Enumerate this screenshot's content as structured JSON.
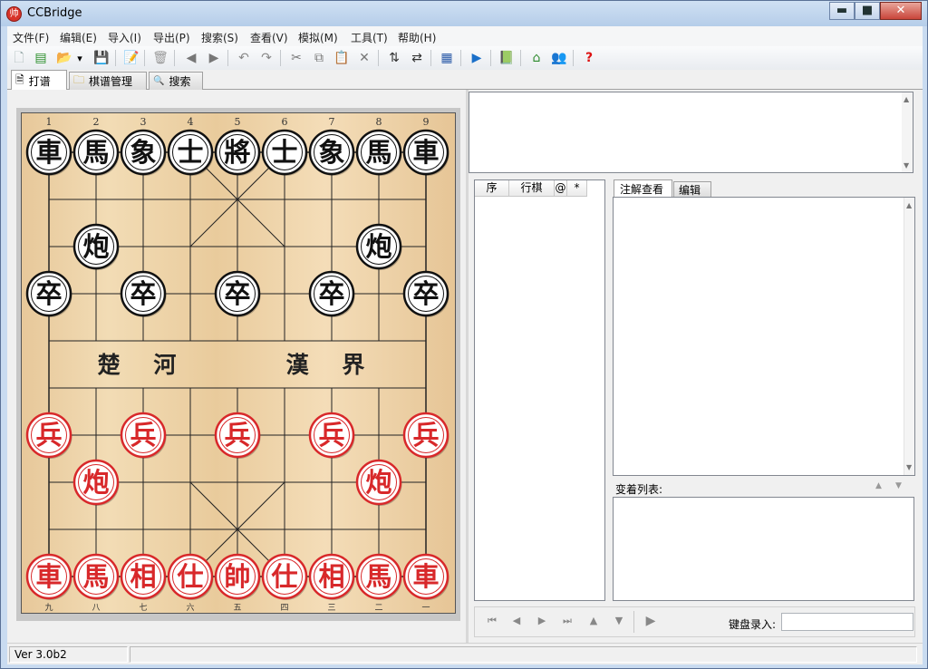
{
  "window": {
    "title": "CCBridge",
    "minimize": "▬",
    "maximize": "■",
    "close": "✕"
  },
  "menu": [
    "文件(F)",
    "编辑(E)",
    "导入(I)",
    "导出(P)",
    "搜索(S)",
    "查看(V)",
    "模拟(M)",
    "工具(T)",
    "帮助(H)"
  ],
  "toolbar": {
    "icons": [
      "new-file-icon",
      "green-grid-icon",
      "open-folder-icon",
      "dropdown-arrow-icon",
      "save-disk-icon",
      "edit-page-icon",
      "trash-icon",
      "back-circle-icon",
      "forward-circle-icon",
      "undo-icon",
      "redo-icon",
      "cut-icon",
      "copy-icon",
      "paste-icon",
      "delete-x-icon",
      "flip-vertical-icon",
      "flip-horizontal-icon",
      "board-view-icon",
      "play-circle-icon",
      "book-icon",
      "home-arrow-icon",
      "people-icon",
      "help-icon"
    ],
    "glyphs": [
      "🗋",
      "▤",
      "📂",
      "▾",
      "💾",
      "📝",
      "🗑",
      "◀",
      "▶",
      "↶",
      "↷",
      "✂",
      "⧉",
      "📋",
      "✕",
      "⇅",
      "⇄",
      "▦",
      "▶",
      "📗",
      "⌂",
      "👥",
      "?"
    ]
  },
  "tabs": [
    {
      "label": "打谱",
      "icon": "document-icon",
      "glyph": "🗎"
    },
    {
      "label": "棋谱管理",
      "icon": "folder-icon",
      "glyph": "🗀"
    },
    {
      "label": "搜索",
      "icon": "magnifier-icon",
      "glyph": "🔍"
    }
  ],
  "board": {
    "top_numbers": [
      "1",
      "2",
      "3",
      "4",
      "5",
      "6",
      "7",
      "8",
      "9"
    ],
    "bottom_numbers": [
      "九",
      "八",
      "七",
      "六",
      "五",
      "四",
      "三",
      "二",
      "一"
    ],
    "river_left": "楚 河",
    "river_right": "漢 界",
    "colors": {
      "red": "#d8282a",
      "black": "#111111",
      "piece_face": "#ffffff"
    },
    "pieces": [
      {
        "char": "車",
        "side": "black",
        "file": 0,
        "rank": 0
      },
      {
        "char": "馬",
        "side": "black",
        "file": 1,
        "rank": 0
      },
      {
        "char": "象",
        "side": "black",
        "file": 2,
        "rank": 0
      },
      {
        "char": "士",
        "side": "black",
        "file": 3,
        "rank": 0
      },
      {
        "char": "將",
        "side": "black",
        "file": 4,
        "rank": 0
      },
      {
        "char": "士",
        "side": "black",
        "file": 5,
        "rank": 0
      },
      {
        "char": "象",
        "side": "black",
        "file": 6,
        "rank": 0
      },
      {
        "char": "馬",
        "side": "black",
        "file": 7,
        "rank": 0
      },
      {
        "char": "車",
        "side": "black",
        "file": 8,
        "rank": 0
      },
      {
        "char": "炮",
        "side": "black",
        "file": 1,
        "rank": 2
      },
      {
        "char": "炮",
        "side": "black",
        "file": 7,
        "rank": 2
      },
      {
        "char": "卒",
        "side": "black",
        "file": 0,
        "rank": 3
      },
      {
        "char": "卒",
        "side": "black",
        "file": 2,
        "rank": 3
      },
      {
        "char": "卒",
        "side": "black",
        "file": 4,
        "rank": 3
      },
      {
        "char": "卒",
        "side": "black",
        "file": 6,
        "rank": 3
      },
      {
        "char": "卒",
        "side": "black",
        "file": 8,
        "rank": 3
      },
      {
        "char": "兵",
        "side": "red",
        "file": 0,
        "rank": 6
      },
      {
        "char": "兵",
        "side": "red",
        "file": 2,
        "rank": 6
      },
      {
        "char": "兵",
        "side": "red",
        "file": 4,
        "rank": 6
      },
      {
        "char": "兵",
        "side": "red",
        "file": 6,
        "rank": 6
      },
      {
        "char": "兵",
        "side": "red",
        "file": 8,
        "rank": 6
      },
      {
        "char": "炮",
        "side": "red",
        "file": 1,
        "rank": 7
      },
      {
        "char": "炮",
        "side": "red",
        "file": 7,
        "rank": 7
      },
      {
        "char": "車",
        "side": "red",
        "file": 0,
        "rank": 9
      },
      {
        "char": "馬",
        "side": "red",
        "file": 1,
        "rank": 9
      },
      {
        "char": "相",
        "side": "red",
        "file": 2,
        "rank": 9
      },
      {
        "char": "仕",
        "side": "red",
        "file": 3,
        "rank": 9
      },
      {
        "char": "帥",
        "side": "red",
        "file": 4,
        "rank": 9
      },
      {
        "char": "仕",
        "side": "red",
        "file": 5,
        "rank": 9
      },
      {
        "char": "相",
        "side": "red",
        "file": 6,
        "rank": 9
      },
      {
        "char": "馬",
        "side": "red",
        "file": 7,
        "rank": 9
      },
      {
        "char": "車",
        "side": "red",
        "file": 8,
        "rank": 9
      }
    ]
  },
  "moves": {
    "headers": [
      "序",
      "行棋",
      "@",
      "*"
    ]
  },
  "comment": {
    "tabs": [
      "注解查看",
      "编辑"
    ]
  },
  "variations": {
    "label": "变着列表:"
  },
  "navigation": {
    "icons": [
      "first-move-icon",
      "prev-move-icon",
      "next-move-icon",
      "last-move-icon",
      "variation-up-icon",
      "variation-down-icon",
      "play-icon"
    ],
    "glyphs": [
      "⏮",
      "◀",
      "▶",
      "⏭",
      "▲",
      "▼",
      "▶"
    ]
  },
  "keyboard_input": {
    "label": "键盘录入:",
    "value": ""
  },
  "status": {
    "version": "Ver 3.0b2"
  }
}
